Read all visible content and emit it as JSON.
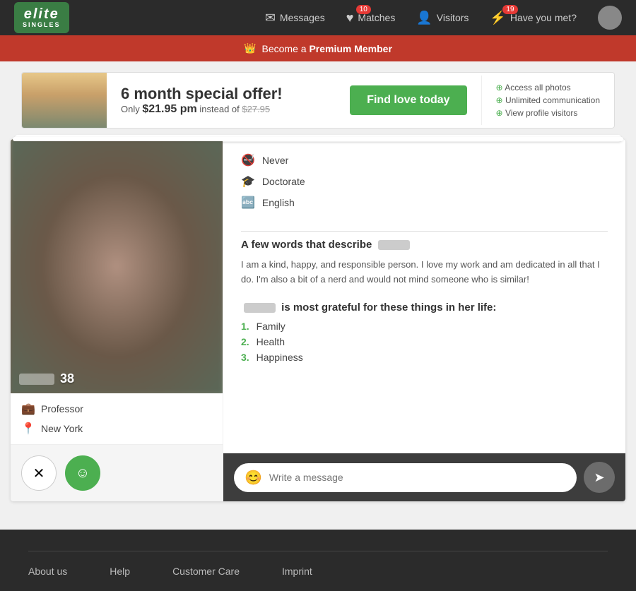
{
  "logo": {
    "brand": "elite",
    "sub": "SINGLES"
  },
  "nav": {
    "messages_label": "Messages",
    "matches_label": "Matches",
    "matches_count": "10",
    "visitors_label": "Visitors",
    "have_you_met_label": "Have you met?",
    "have_you_met_count": "19"
  },
  "premium_banner": {
    "pre": "Become a",
    "link": "Premium Member"
  },
  "ad": {
    "title": "6 month special offer!",
    "subtitle_pre": "Only",
    "price": "$21.95 pm",
    "subtitle_mid": "instead of",
    "old_price": "$27.95",
    "cta": "Find love today",
    "feature1": "Access all photos",
    "feature2": "Unlimited communication",
    "feature3": "View profile visitors"
  },
  "profile": {
    "age": "38",
    "profession": "Professor",
    "location": "New York",
    "attr_smoking": "Never",
    "attr_education": "Doctorate",
    "attr_language": "English",
    "desc_title": "A few words that describe",
    "bio": "I am a kind, happy, and responsible person. I love my work and am dedicated in all that I do. I'm also a bit of a nerd and would not mind someone who is similar!",
    "grateful_title_pre": "is most grateful for these things in her life:",
    "grateful1": "Family",
    "grateful2": "Health",
    "grateful3": "Happiness"
  },
  "message": {
    "placeholder": "Write a message"
  },
  "footer": {
    "about": "About us",
    "help": "Help",
    "customer_care": "Customer Care",
    "imprint": "Imprint"
  }
}
